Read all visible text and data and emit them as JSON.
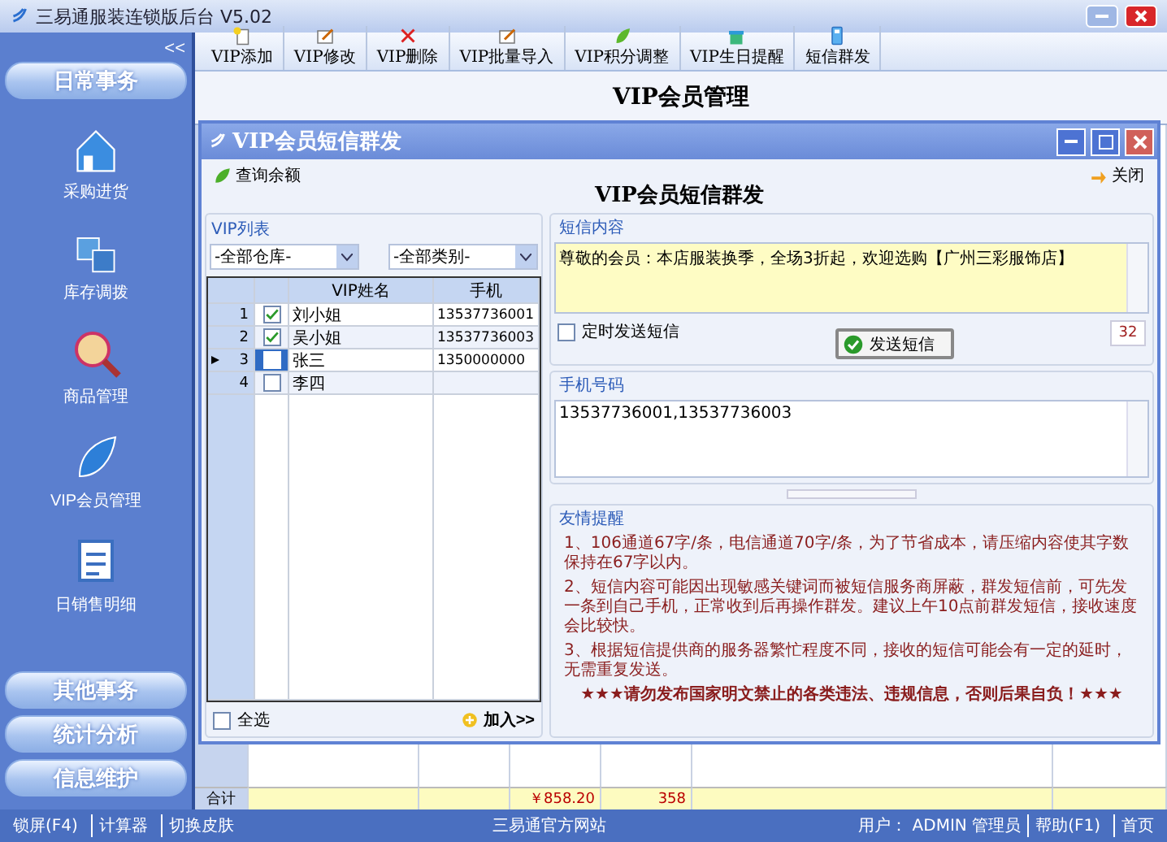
{
  "app": {
    "title": "三易通服装连锁版后台 V5.02"
  },
  "sidebar": {
    "collapse": "<<",
    "top_sections": [
      {
        "label": "日常事务"
      }
    ],
    "items": [
      {
        "label": "采购进货",
        "kind": "house"
      },
      {
        "label": "库存调拨",
        "kind": "transfer"
      },
      {
        "label": "商品管理",
        "kind": "magnifier"
      },
      {
        "label": "VIP会员管理",
        "kind": "leaf"
      },
      {
        "label": "日销售明细",
        "kind": "document"
      }
    ],
    "bottom_sections": [
      {
        "label": "其他事务"
      },
      {
        "label": "统计分析"
      },
      {
        "label": "信息维护"
      }
    ]
  },
  "toolbar": [
    {
      "label": "VIP添加",
      "kind": "new"
    },
    {
      "label": "VIP修改",
      "kind": "edit"
    },
    {
      "label": "VIP删除",
      "kind": "delete"
    },
    {
      "label": "VIP批量导入",
      "kind": "edit"
    },
    {
      "label": "VIP积分调整",
      "kind": "leaf"
    },
    {
      "label": "VIP生日提醒",
      "kind": "gift"
    },
    {
      "label": "短信群发",
      "kind": "phone"
    }
  ],
  "page_title": "VIP会员管理",
  "background_table": {
    "total_label": "合计",
    "total_amount": "￥858.20",
    "total_quantity": "358"
  },
  "dialog": {
    "title": "VIP会员短信群发",
    "query_balance": "查询余额",
    "close": "关闭",
    "heading": "VIP会员短信群发",
    "vip_list": {
      "legend": "VIP列表",
      "warehouse": "-全部仓库-",
      "category": "-全部类别-",
      "columns": [
        "VIP姓名",
        "手机"
      ],
      "rows": [
        {
          "number": "1",
          "name": "刘小姐",
          "phone": "13537736001",
          "checked": true,
          "selected": false
        },
        {
          "number": "2",
          "name": "吴小姐",
          "phone": "13537736003",
          "checked": true,
          "selected": false
        },
        {
          "number": "3",
          "name": "张三",
          "phone": "1350000000",
          "checked": false,
          "selected": true
        },
        {
          "number": "4",
          "name": "李四",
          "checked": false,
          "selected": false
        }
      ],
      "select_all": {
        "label": "全选",
        "checked": false
      },
      "add_button": "加入>>"
    },
    "sms": {
      "legend": "短信内容",
      "content": "尊敬的会员：本店服装换季，全场3折起，欢迎选购【广州三彩服饰店】",
      "scheduled": {
        "label": "定时发送短信",
        "checked": false
      },
      "send_button": "发送短信",
      "char_count": "32"
    },
    "phones": {
      "legend": "手机号码",
      "value": "13537736001,13537736003"
    },
    "tips": {
      "legend": "友情提醒",
      "items": [
        "1、106通道67字/条，电信通道70字/条，为了节省成本，请压缩内容使其字数保持在67字以内。",
        "2、短信内容可能因出现敏感关键词而被短信服务商屏蔽，群发短信前，可先发一条到自己手机，正常收到后再操作群发。建议上午10点前群发短信，接收速度会比较快。",
        "3、根据短信提供商的服务器繁忙程度不同，接收的短信可能会有一定的延时，无需重复发送。"
      ],
      "warning": "★★★请勿发布国家明文禁止的各类违法、违规信息，否则后果自负！★★★"
    }
  },
  "status_bar": {
    "left": [
      "锁屏(F4)",
      "计算器",
      "切换皮肤"
    ],
    "center": "三易通官方网站",
    "user": "用户： ADMIN 管理员",
    "right": [
      "帮助(F1)",
      "首页"
    ]
  }
}
